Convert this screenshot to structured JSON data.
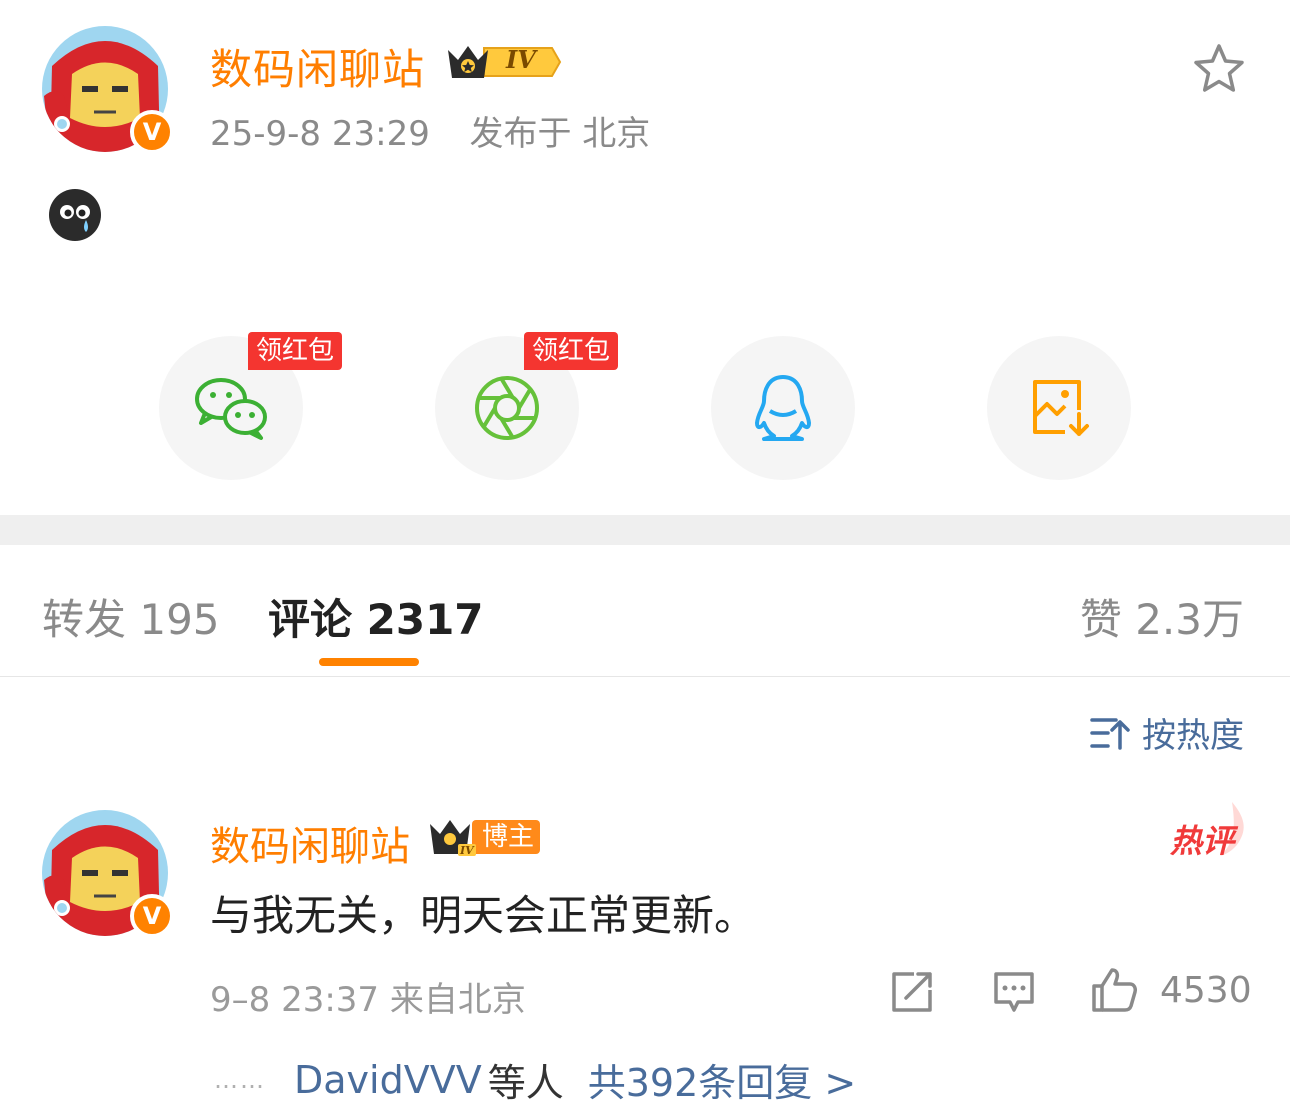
{
  "post": {
    "author": "数码闲聊站",
    "level_badge": "IV",
    "verified_mark": "V",
    "time": "25-9-8 23:29",
    "location": "发布于 北京",
    "emoji_icon": "crying-face-icon"
  },
  "share": {
    "items": [
      {
        "name": "wechat",
        "tag": "领红包",
        "color": "#3cb034"
      },
      {
        "name": "moments",
        "tag": "领红包",
        "color": "#66c13a"
      },
      {
        "name": "qq",
        "tag": "",
        "color": "#24a8f1"
      },
      {
        "name": "save-image",
        "tag": "",
        "color": "#ff9f00"
      }
    ]
  },
  "tabs": {
    "repost": "转发 195",
    "comment": "评论 2317",
    "like": "赞 2.3万"
  },
  "sort": {
    "label": "按热度"
  },
  "comment": {
    "author": "数码闲聊站",
    "level_badge": "IV",
    "role_badge": "博主",
    "hot_tag": "热评",
    "text": "与我无关，明天会正常更新。",
    "meta": "9–8 23:37 来自北京",
    "like_count": "4530",
    "replies": {
      "dots": "……",
      "users": "DavidVVV",
      "mid": "等人",
      "total": "共392条回复 >"
    }
  },
  "colors": {
    "accent": "#ff8200",
    "name": "#ff7e00",
    "link": "#496c9b",
    "red_tag": "#f43530"
  }
}
